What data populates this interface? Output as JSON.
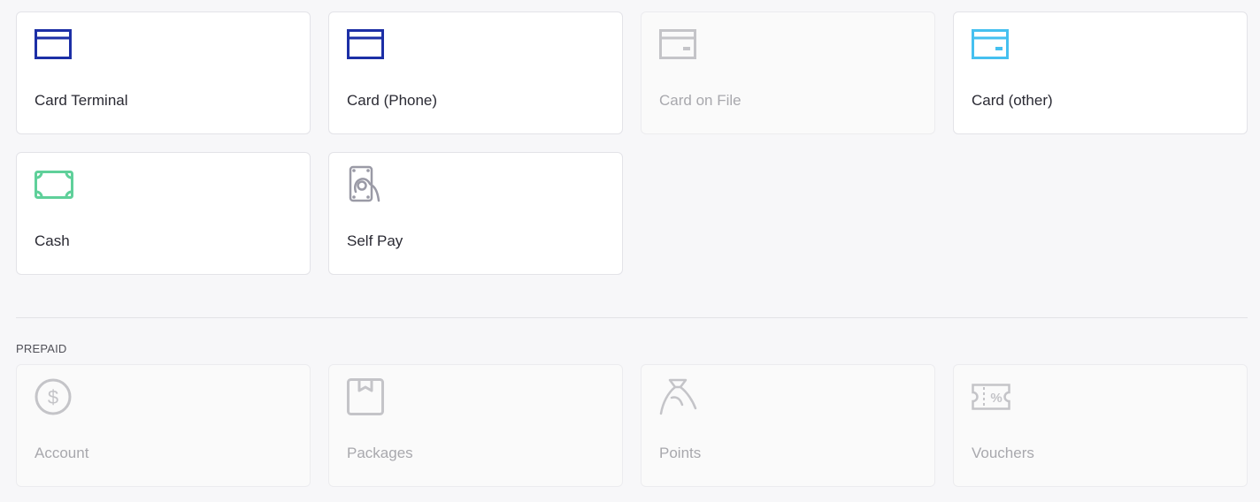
{
  "payment_methods": [
    {
      "label": "Card Terminal",
      "icon": "card-icon",
      "color": "#1c2fa6",
      "disabled": false
    },
    {
      "label": "Card (Phone)",
      "icon": "card-icon",
      "color": "#1c2fa6",
      "disabled": false
    },
    {
      "label": "Card on File",
      "icon": "card-on-file-icon",
      "color": "#c4c4c8",
      "disabled": true
    },
    {
      "label": "Card (other)",
      "icon": "card-other-icon",
      "color": "#45c0f0",
      "disabled": false
    },
    {
      "label": "Cash",
      "icon": "cash-icon",
      "color": "#5fd09a",
      "disabled": false
    },
    {
      "label": "Self Pay",
      "icon": "self-pay-icon",
      "color": "#9a9aa6",
      "disabled": false
    }
  ],
  "prepaid": {
    "title": "PREPAID",
    "items": [
      {
        "label": "Account",
        "icon": "dollar-coin-icon",
        "color": "#c4c4c8",
        "disabled": true
      },
      {
        "label": "Packages",
        "icon": "package-icon",
        "color": "#c4c4c8",
        "disabled": true
      },
      {
        "label": "Points",
        "icon": "points-bag-icon",
        "color": "#c4c4c8",
        "disabled": true
      },
      {
        "label": "Vouchers",
        "icon": "voucher-icon",
        "color": "#c4c4c8",
        "disabled": true
      }
    ]
  }
}
